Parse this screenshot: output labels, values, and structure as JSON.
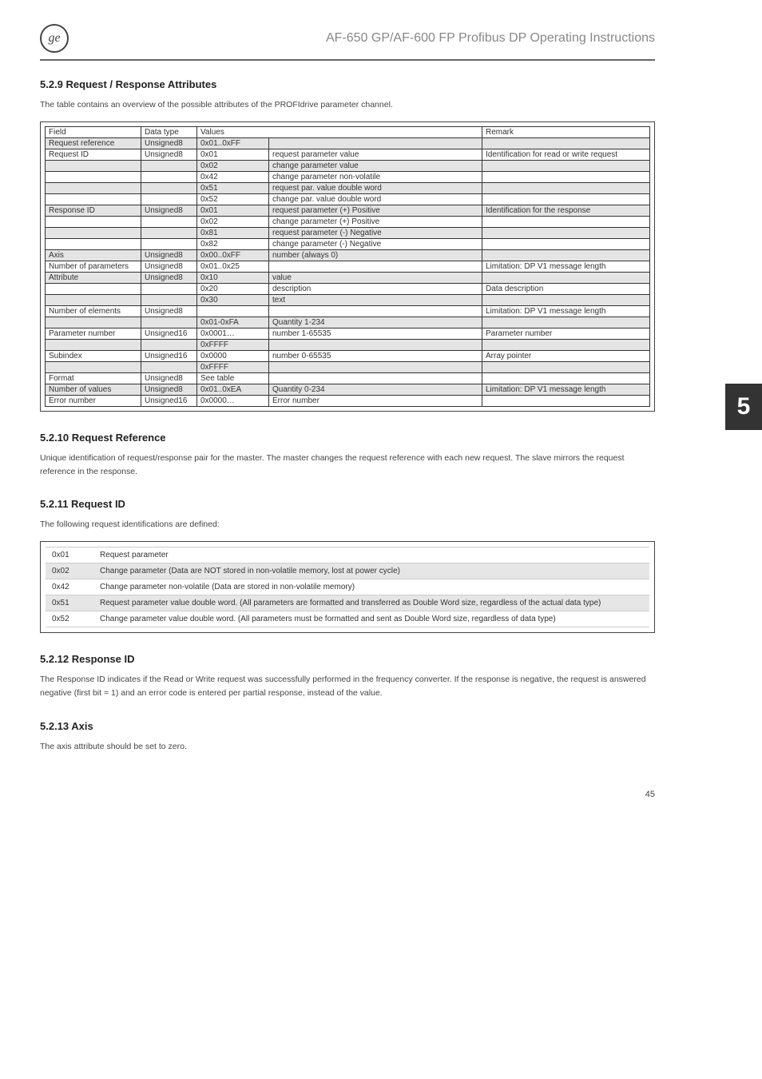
{
  "header": {
    "logo_text": "ge",
    "doc_title": "AF-650 GP/AF-600 FP Profibus DP Operating Instructions"
  },
  "side_tab": "5",
  "page_number": "45",
  "s529": {
    "heading": "5.2.9  Request / Response Attributes",
    "intro": "The table contains an overview of the possible attributes of the PROFIdrive parameter channel.",
    "cols": {
      "field": "Field",
      "type": "Data type",
      "values": "Values",
      "remark": "Remark"
    },
    "rows": [
      {
        "field": "Request reference",
        "type": "Unsigned8",
        "val": "0x01..0xFF",
        "desc": "",
        "remark": "",
        "shade": true
      },
      {
        "field": "Request ID",
        "type": "Unsigned8",
        "val": "0x01",
        "desc": "request parameter value",
        "remark": "Identification for read or write request"
      },
      {
        "field": "",
        "type": "",
        "val": "0x02",
        "desc": "change parameter value",
        "remark": "",
        "shade": true
      },
      {
        "field": "",
        "type": "",
        "val": "0x42",
        "desc": "change parameter non-volatile",
        "remark": ""
      },
      {
        "field": "",
        "type": "",
        "val": "0x51",
        "desc": "request par. value double word",
        "remark": "",
        "shade": true
      },
      {
        "field": "",
        "type": "",
        "val": "0x52",
        "desc": "change par. value double word",
        "remark": ""
      },
      {
        "field": "Response ID",
        "type": "Unsigned8",
        "val": "0x01",
        "desc": "request parameter (+) Positive",
        "remark": "Identification for the response",
        "shade": true
      },
      {
        "field": "",
        "type": "",
        "val": "0x02",
        "desc": "change parameter (+) Positive",
        "remark": ""
      },
      {
        "field": "",
        "type": "",
        "val": "0x81",
        "desc": "request parameter (-) Negative",
        "remark": "",
        "shade": true
      },
      {
        "field": "",
        "type": "",
        "val": "0x82",
        "desc": "change parameter (-) Negative",
        "remark": ""
      },
      {
        "field": "Axis",
        "type": "Unsigned8",
        "val": "0x00..0xFF",
        "desc": "number (always 0)",
        "remark": "",
        "shade": true
      },
      {
        "field": "Number of parameters",
        "type": "Unsigned8",
        "val": "0x01..0x25",
        "desc": "",
        "remark": "Limitation: DP V1 message length"
      },
      {
        "field": "Attribute",
        "type": "Unsigned8",
        "val": "0x10",
        "desc": "value",
        "remark": "",
        "shade": true
      },
      {
        "field": "",
        "type": "",
        "val": "0x20",
        "desc": "description",
        "remark": "Data description"
      },
      {
        "field": "",
        "type": "",
        "val": "0x30",
        "desc": "text",
        "remark": "",
        "shade": true
      },
      {
        "field": "Number of elements",
        "type": "Unsigned8",
        "val": "",
        "desc": "",
        "remark": "Limitation: DP V1 message length"
      },
      {
        "field": "",
        "type": "",
        "val": "0x01-0xFA",
        "desc": "Quantity 1-234",
        "remark": "",
        "shade": true
      },
      {
        "field": "Parameter number",
        "type": "Unsigned16",
        "val": "0x0001…",
        "desc": "number 1-65535",
        "remark": "Parameter number"
      },
      {
        "field": "",
        "type": "",
        "val": "0xFFFF",
        "desc": "",
        "remark": "",
        "shade": true
      },
      {
        "field": "Subindex",
        "type": "Unsigned16",
        "val": "0x0000",
        "desc": "number 0-65535",
        "remark": "Array pointer"
      },
      {
        "field": "",
        "type": "",
        "val": "0xFFFF",
        "desc": "",
        "remark": "",
        "shade": true
      },
      {
        "field": "Format",
        "type": "Unsigned8",
        "val": "See table",
        "desc": "",
        "remark": ""
      },
      {
        "field": "Number of values",
        "type": "Unsigned8",
        "val": "0x01..0xEA",
        "desc": "Quantity 0-234",
        "remark": "Limitation: DP V1 message length",
        "shade": true
      },
      {
        "field": "Error number",
        "type": "Unsigned16",
        "val": "0x0000…",
        "desc": "Error number",
        "remark": ""
      }
    ]
  },
  "s5210": {
    "heading": "5.2.10  Request Reference",
    "text": "Unique identification of request/response pair for the master. The master changes the request reference with each new request. The slave mirrors the request reference in the response."
  },
  "s5211": {
    "heading": "5.2.11  Request ID",
    "intro": "The following request identifications are defined:",
    "rows": [
      {
        "code": "0x01",
        "text": "Request parameter",
        "sh": false
      },
      {
        "code": "0x02",
        "text": "Change parameter (Data are NOT stored in non-volatile memory, lost at power cycle)",
        "sh": true
      },
      {
        "code": "0x42",
        "text": "Change parameter non-volatile (Data are stored in non-volatile memory)",
        "sh": false
      },
      {
        "code": "0x51",
        "text": "Request parameter value double word. (All parameters are formatted and transferred as Double Word size, regardless of the actual data type)",
        "sh": true
      },
      {
        "code": "0x52",
        "text": "Change parameter value double word. (All parameters must be formatted and sent as Double Word size, regardless of data type)",
        "sh": false
      }
    ]
  },
  "s5212": {
    "heading": "5.2.12  Response ID",
    "text": "The Response ID indicates if the Read or Write request was successfully performed in the frequency converter. If the response is negative, the request is answered negative (first bit = 1) and an error code is entered per partial response, instead of the value."
  },
  "s5213": {
    "heading": "5.2.13  Axis",
    "text": "The axis attribute should be set to zero."
  }
}
